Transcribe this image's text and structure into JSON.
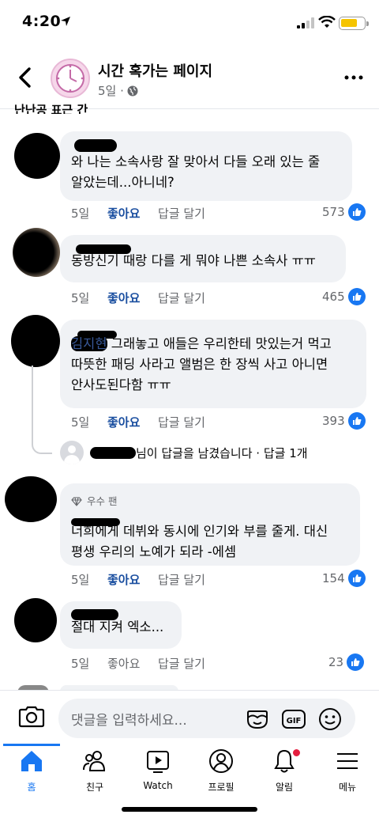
{
  "status": {
    "time": "4:20"
  },
  "header": {
    "page_name": "시간 혹가는 페이지",
    "posted": "5일 ·"
  },
  "partial_text": "난난공 표근 간",
  "comments": [
    {
      "text_line1": "와 나는 소속사랑 잘 맞아서 다들 오래 있는 줄",
      "text_line2": "알았는데...아니네?",
      "time": "5일",
      "like": "좋아요",
      "reply": "답글 달기",
      "count": "573"
    },
    {
      "text_line1": "동방신기 때랑 다를 게 뭐야 나쁜 소속사 ㅠㅠ",
      "time": "5일",
      "like": "좋아요",
      "reply": "답글 달기",
      "count": "465"
    },
    {
      "mention": "김지현",
      "text_line1": " 그래놓고 애들은 우리한테 맛있는거 먹고",
      "text_line2": "따뜻한 패딩 사라고 앨범은 한 장씩 사고 아니면",
      "text_line3": "안사도된다함 ㅠㅠ",
      "time": "5일",
      "like": "좋아요",
      "reply": "답글 달기",
      "count": "393"
    },
    {
      "badge": "우수 팬",
      "text_line1": "너희에게 데뷔와 동시에 인기와 부를 줄게. 대신",
      "text_line2": "평생 우리의 노예가 되라 -에셈",
      "time": "5일",
      "like": "좋아요",
      "reply": "답글 달기",
      "count": "154"
    },
    {
      "text_line1": "절대 지켜 엑소...",
      "time": "5일",
      "like": "좋아요",
      "reply": "답글 달기",
      "count": "23"
    }
  ],
  "reply_summary": {
    "text": "님이 답글을 남겼습니다 · 답글 1개"
  },
  "composer": {
    "placeholder": "댓글을 입력하세요..."
  },
  "tabs": [
    {
      "label": "홈",
      "icon": "home-icon"
    },
    {
      "label": "친구",
      "icon": "friends-icon"
    },
    {
      "label": "Watch",
      "icon": "watch-icon"
    },
    {
      "label": "프로필",
      "icon": "profile-icon"
    },
    {
      "label": "알림",
      "icon": "bell-icon"
    },
    {
      "label": "메뉴",
      "icon": "menu-icon"
    }
  ],
  "colors": {
    "accent": "#1877f2",
    "like_text": "#1b4fa0",
    "bubble": "#f0f2f5",
    "notification": "#e41e3f"
  }
}
